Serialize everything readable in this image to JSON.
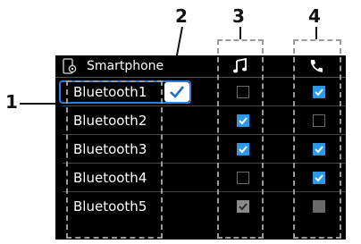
{
  "callouts": [
    "1",
    "2",
    "3",
    "4"
  ],
  "header": {
    "title": "Smartphone",
    "icons": {
      "phone_settings": "phone-settings-icon",
      "music": "music-icon",
      "call": "phone-call-icon"
    }
  },
  "rows": [
    {
      "name": "Bluetooth1",
      "selected": true,
      "music": "unchecked",
      "call": "checked"
    },
    {
      "name": "Bluetooth2",
      "selected": false,
      "music": "checked",
      "call": "unchecked"
    },
    {
      "name": "Bluetooth3",
      "selected": false,
      "music": "checked",
      "call": "checked"
    },
    {
      "name": "Bluetooth4",
      "selected": false,
      "music": "unchecked",
      "call": "checked"
    },
    {
      "name": "Bluetooth5",
      "selected": false,
      "music": "checked-disabled",
      "call": "disabled"
    }
  ],
  "colors": {
    "accent": "#2d97ea",
    "selection": "#2f7fd8",
    "panel_bg": "#000000",
    "dashed": "#9a9a9a"
  }
}
